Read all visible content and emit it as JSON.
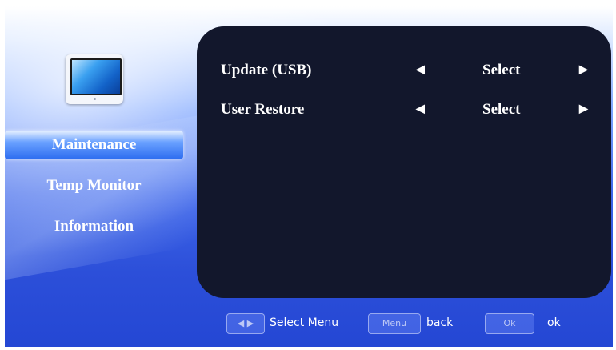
{
  "sidebar": {
    "icon": "monitor-icon",
    "items": [
      {
        "label": "Maintenance",
        "active": true
      },
      {
        "label": "Temp Monitor",
        "active": false
      },
      {
        "label": "Information",
        "active": false
      }
    ]
  },
  "panel": {
    "rows": [
      {
        "label": "Update (USB)",
        "value": "Select",
        "left_arrow": "◀",
        "right_arrow": "▶"
      },
      {
        "label": "User Restore",
        "value": "Select",
        "left_arrow": "◀",
        "right_arrow": "▶"
      }
    ]
  },
  "footer": {
    "nav_key": "◀ ▶",
    "nav_label": "Select Menu",
    "menu_key": "Menu",
    "menu_label": "back",
    "ok_key": "Ok",
    "ok_label": "ok"
  },
  "colors": {
    "panel_bg": "#12172c",
    "active_item": "#2c6cf0",
    "background_blue": "#2c4fd9"
  }
}
